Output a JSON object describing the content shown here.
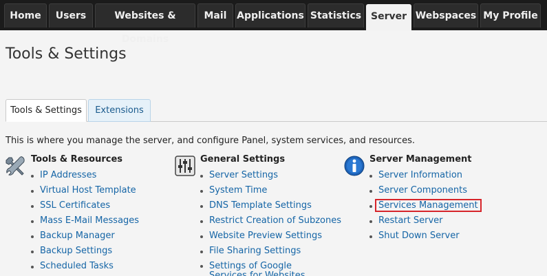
{
  "nav": {
    "tabs": [
      {
        "label": "Home"
      },
      {
        "label": "Users"
      },
      {
        "label": "Websites & Domains"
      },
      {
        "label": "Mail"
      },
      {
        "label": "Applications"
      },
      {
        "label": "Statistics"
      },
      {
        "label": "Server"
      },
      {
        "label": "Webspaces"
      },
      {
        "label": "My Profile"
      }
    ],
    "active": "Server"
  },
  "page": {
    "title": "Tools & Settings",
    "intro": "This is where you manage the server, and configure Panel, system services, and resources."
  },
  "subtabs": [
    {
      "label": "Tools & Settings"
    },
    {
      "label": "Extensions"
    }
  ],
  "columns": [
    {
      "title": "Tools & Resources",
      "icon": "tools-icon",
      "items": [
        "IP Addresses",
        "Virtual Host Template",
        "SSL Certificates",
        "Mass E-Mail Messages",
        "Backup Manager",
        "Backup Settings",
        "Scheduled Tasks"
      ]
    },
    {
      "title": "General Settings",
      "icon": "sliders-icon",
      "items": [
        "Server Settings",
        "System Time",
        "DNS Template Settings",
        "Restrict Creation of Subzones",
        "Website Preview Settings",
        "File Sharing Settings",
        "Settings of Google Services for Websites"
      ]
    },
    {
      "title": "Server Management",
      "icon": "info-icon",
      "items": [
        "Server Information",
        "Server Components",
        "Services Management",
        "Restart Server",
        "Shut Down Server"
      ]
    }
  ],
  "colors": {
    "link": "#1565a6",
    "highlight": "#d6242a",
    "topbar": "#1b1b1b"
  }
}
